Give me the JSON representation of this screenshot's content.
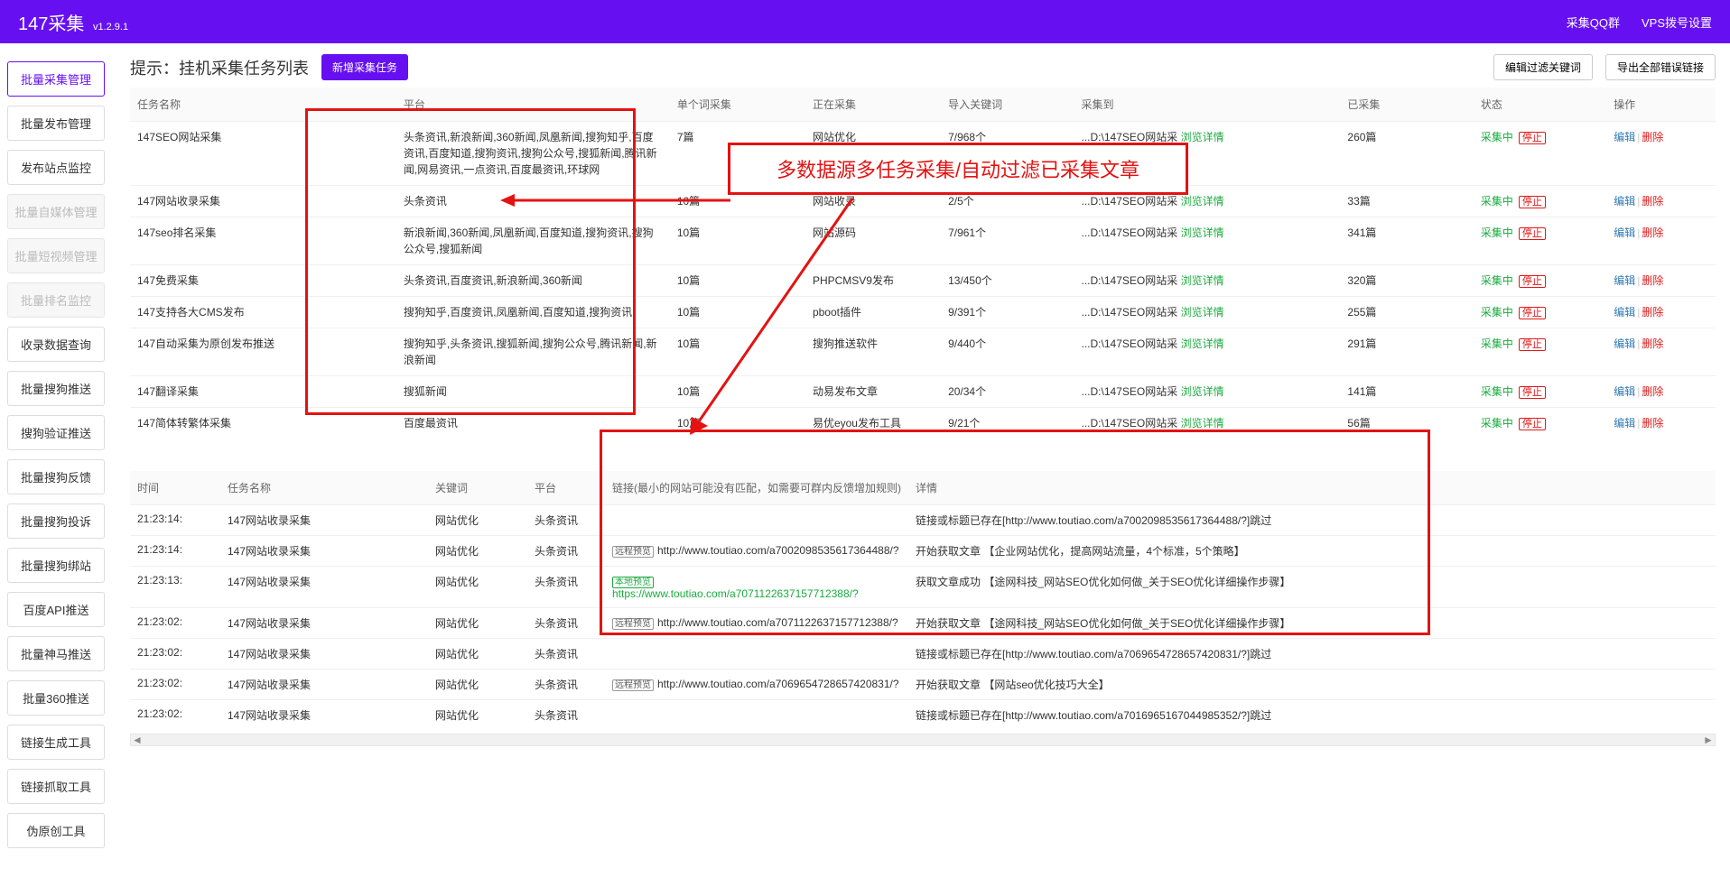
{
  "header": {
    "title": "147采集",
    "version": "v1.2.9.1",
    "link_qq": "采集QQ群",
    "link_vps": "VPS拨号设置"
  },
  "sidebar": {
    "items": [
      {
        "label": "批量采集管理",
        "state": "active"
      },
      {
        "label": "批量发布管理",
        "state": ""
      },
      {
        "label": "发布站点监控",
        "state": ""
      },
      {
        "label": "批量自媒体管理",
        "state": "disabled"
      },
      {
        "label": "批量短视频管理",
        "state": "disabled"
      },
      {
        "label": "批量排名监控",
        "state": "disabled"
      },
      {
        "label": "收录数据查询",
        "state": ""
      },
      {
        "label": "批量搜狗推送",
        "state": ""
      },
      {
        "label": "搜狗验证推送",
        "state": ""
      },
      {
        "label": "批量搜狗反馈",
        "state": ""
      },
      {
        "label": "批量搜狗投诉",
        "state": ""
      },
      {
        "label": "批量搜狗绑站",
        "state": ""
      },
      {
        "label": "百度API推送",
        "state": ""
      },
      {
        "label": "批量神马推送",
        "state": ""
      },
      {
        "label": "批量360推送",
        "state": ""
      },
      {
        "label": "链接生成工具",
        "state": ""
      },
      {
        "label": "链接抓取工具",
        "state": ""
      },
      {
        "label": "伪原创工具",
        "state": ""
      }
    ]
  },
  "page": {
    "title": "提示：挂机采集任务列表",
    "new_task_btn": "新增采集任务",
    "filter_btn": "编辑过滤关键词",
    "export_btn": "导出全部错误链接"
  },
  "annotation": {
    "callout": "多数据源多任务采集/自动过滤已采集文章"
  },
  "tasks": {
    "headers": {
      "name": "任务名称",
      "platform": "平台",
      "single": "单个词采集",
      "collecting": "正在采集",
      "import_kw": "导入关键词",
      "save_to": "采集到",
      "detail": "",
      "collected": "已采集",
      "status": "状态",
      "op": "操作"
    },
    "detail_link": "浏览详情",
    "status_running": "采集中",
    "status_stop": "停止",
    "op_edit": "编辑",
    "op_delete": "删除",
    "rows": [
      {
        "name": "147SEO网站采集",
        "platform": "头条资讯,新浪新闻,360新闻,凤凰新闻,搜狗知乎,百度资讯,百度知道,搜狗资讯,搜狗公众号,搜狐新闻,腾讯新闻,网易资讯,一点资讯,百度最资讯,环球网",
        "single": "7篇",
        "collecting": "网站优化",
        "import_kw": "7/968个",
        "save_to": "...D:\\147SEO网站采",
        "collected": "260篇"
      },
      {
        "name": "147网站收录采集",
        "platform": "头条资讯",
        "single": "10篇",
        "collecting": "网站收录",
        "import_kw": "2/5个",
        "save_to": "...D:\\147SEO网站采",
        "collected": "33篇"
      },
      {
        "name": "147seo排名采集",
        "platform": "新浪新闻,360新闻,凤凰新闻,百度知道,搜狗资讯,搜狗公众号,搜狐新闻",
        "single": "10篇",
        "collecting": "网站源码",
        "import_kw": "7/961个",
        "save_to": "...D:\\147SEO网站采",
        "collected": "341篇"
      },
      {
        "name": "147免费采集",
        "platform": "头条资讯,百度资讯,新浪新闻,360新闻",
        "single": "10篇",
        "collecting": "PHPCMSV9发布",
        "import_kw": "13/450个",
        "save_to": "...D:\\147SEO网站采",
        "collected": "320篇"
      },
      {
        "name": "147支持各大CMS发布",
        "platform": "搜狗知乎,百度资讯,凤凰新闻,百度知道,搜狗资讯",
        "single": "10篇",
        "collecting": "pboot插件",
        "import_kw": "9/391个",
        "save_to": "...D:\\147SEO网站采",
        "collected": "255篇"
      },
      {
        "name": "147自动采集为原创发布推送",
        "platform": "搜狗知乎,头条资讯,搜狐新闻,搜狗公众号,腾讯新闻,新浪新闻",
        "single": "10篇",
        "collecting": "搜狗推送软件",
        "import_kw": "9/440个",
        "save_to": "...D:\\147SEO网站采",
        "collected": "291篇"
      },
      {
        "name": "147翻译采集",
        "platform": "搜狐新闻",
        "single": "10篇",
        "collecting": "动易发布文章",
        "import_kw": "20/34个",
        "save_to": "...D:\\147SEO网站采",
        "collected": "141篇"
      },
      {
        "name": "147简体转繁体采集",
        "platform": "百度最资讯",
        "single": "10篇",
        "collecting": "易优eyou发布工具",
        "import_kw": "9/21个",
        "save_to": "...D:\\147SEO网站采",
        "collected": "56篇"
      }
    ]
  },
  "logs": {
    "headers": {
      "time": "时间",
      "task": "任务名称",
      "kw": "关键词",
      "platform": "平台",
      "link": "链接(最小的网站可能没有匹配，如需要可群内反馈增加规则)",
      "detail": "详情"
    },
    "remote_tag": "远程预览",
    "local_tag": "本地预览",
    "rows": [
      {
        "time": "21:23:14:",
        "task": "147网站收录采集",
        "kw": "网站优化",
        "platform": "头条资讯",
        "link_type": "",
        "link": "",
        "detail": "链接或标题已存在[http://www.toutiao.com/a7002098535617364488/?]跳过"
      },
      {
        "time": "21:23:14:",
        "task": "147网站收录采集",
        "kw": "网站优化",
        "platform": "头条资讯",
        "link_type": "remote",
        "link": "http://www.toutiao.com/a7002098535617364488/?",
        "detail": "开始获取文章 【企业网站优化，提高网站流量，4个标准，5个策略】"
      },
      {
        "time": "21:23:13:",
        "task": "147网站收录采集",
        "kw": "网站优化",
        "platform": "头条资讯",
        "link_type": "local",
        "link": "https://www.toutiao.com/a7071122637157712388/?",
        "detail": "获取文章成功 【途网科技_网站SEO优化如何做_关于SEO优化详细操作步骤】"
      },
      {
        "time": "21:23:02:",
        "task": "147网站收录采集",
        "kw": "网站优化",
        "platform": "头条资讯",
        "link_type": "remote",
        "link": "http://www.toutiao.com/a7071122637157712388/?",
        "detail": "开始获取文章 【途网科技_网站SEO优化如何做_关于SEO优化详细操作步骤】"
      },
      {
        "time": "21:23:02:",
        "task": "147网站收录采集",
        "kw": "网站优化",
        "platform": "头条资讯",
        "link_type": "",
        "link": "",
        "detail": "链接或标题已存在[http://www.toutiao.com/a7069654728657420831/?]跳过"
      },
      {
        "time": "21:23:02:",
        "task": "147网站收录采集",
        "kw": "网站优化",
        "platform": "头条资讯",
        "link_type": "remote",
        "link": "http://www.toutiao.com/a7069654728657420831/?",
        "detail": "开始获取文章 【网站seo优化技巧大全】"
      },
      {
        "time": "21:23:02:",
        "task": "147网站收录采集",
        "kw": "网站优化",
        "platform": "头条资讯",
        "link_type": "",
        "link": "",
        "detail": "链接或标题已存在[http://www.toutiao.com/a7016965167044985352/?]跳过"
      }
    ]
  }
}
